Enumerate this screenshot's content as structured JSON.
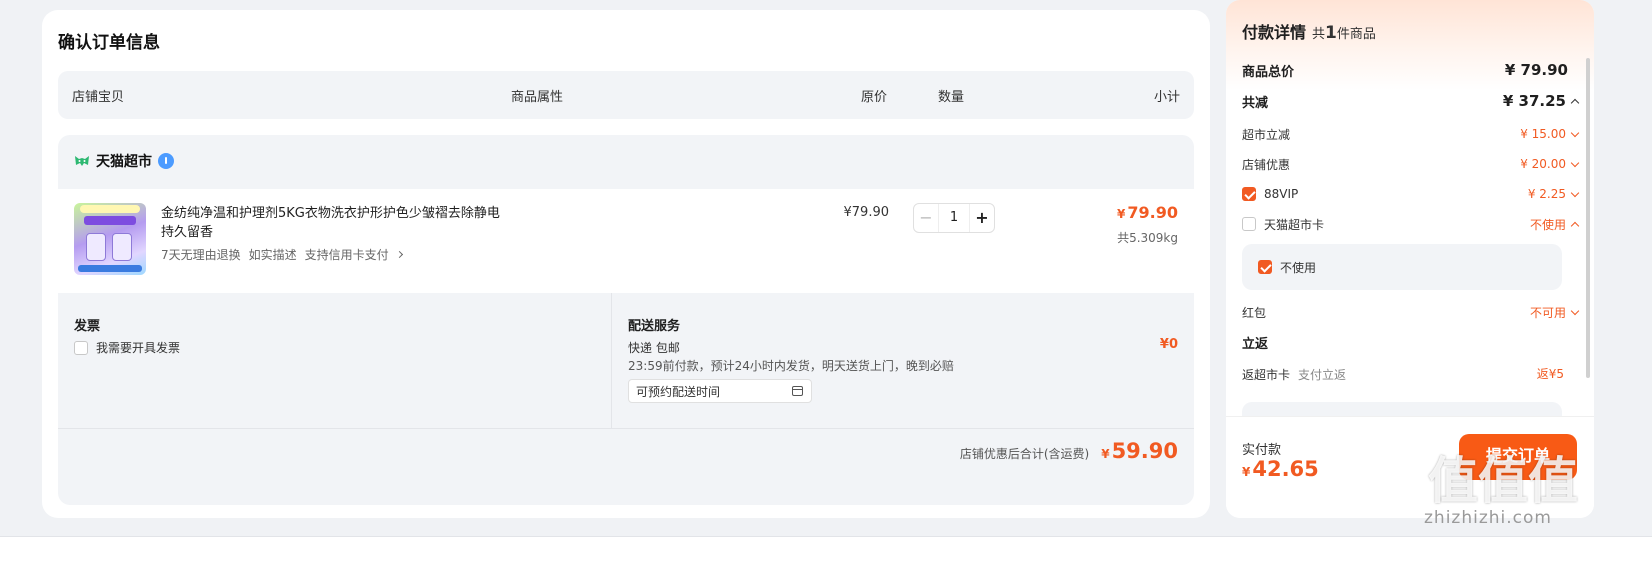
{
  "order": {
    "title": "确认订单信息",
    "headers": {
      "shop_item": "店铺宝贝",
      "attributes": "商品属性",
      "orig_price": "原价",
      "quantity": "数量",
      "subtotal": "小计"
    },
    "shop": {
      "name": "天猫超市",
      "item": {
        "title": "金纺纯净温和护理剂5KG衣物洗衣护形护色少皱褶去除静电 持久留香",
        "tags": [
          "7天无理由退换",
          "如实描述",
          "支持信用卡支付"
        ],
        "price": "¥79.90",
        "qty": "1",
        "minus": "−",
        "plus": "+",
        "subtotal_yen": "¥",
        "subtotal": "79.90",
        "weight": "共5.309kg"
      },
      "invoice": {
        "title": "发票",
        "checkbox_label": "我需要开具发票"
      },
      "delivery": {
        "title": "配送服务",
        "type": "快递 包邮",
        "promise": "23:59前付款，预计24小时内发货，明天送货上门，晚到必赔",
        "time_picker": "可预约配送时间",
        "fee": "¥0"
      },
      "total_label": "店铺优惠后合计(含运费)",
      "total_yen": "¥",
      "total": "59.90"
    }
  },
  "payment": {
    "title": "付款详情",
    "count_prefix": "共",
    "count": "1",
    "count_suffix": "件商品",
    "rows": {
      "goods_total_label": "商品总价",
      "goods_total": "¥ 79.90",
      "discount_label": "共减",
      "discount": "¥ 37.25",
      "supermarket_off_label": "超市立减",
      "supermarket_off": "¥ 15.00",
      "shop_coupon_label": "店铺优惠",
      "shop_coupon": "¥ 20.00",
      "vip_label": "88VIP",
      "vip": "¥ 2.25",
      "tmall_card_label": "天猫超市卡",
      "tmall_card": "不使用",
      "nouse_label": "不使用",
      "redpacket_label": "红包",
      "redpacket": "不可用",
      "return_title": "立返",
      "return_label": "返超市卡",
      "return_sub": "支付立返",
      "return_value": "返¥5"
    },
    "actual_label": "实付款",
    "actual_yen": "¥",
    "actual": "42.65",
    "submit": "提交订单"
  },
  "watermark": {
    "chars": "值值值",
    "url": "zhizhizhi.com"
  },
  "colors": {
    "accent": "#f15a22",
    "button": "#f85a15",
    "panel_bg": "#f2f4f7"
  }
}
